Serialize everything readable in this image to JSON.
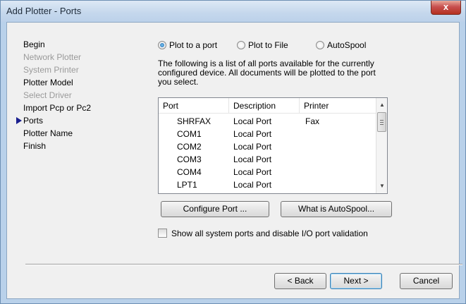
{
  "window": {
    "title": "Add Plotter - Ports",
    "close_label": "x"
  },
  "nav": {
    "items": [
      {
        "label": "Begin",
        "state": "normal"
      },
      {
        "label": "Network Plotter",
        "state": "disabled"
      },
      {
        "label": "System Printer",
        "state": "disabled"
      },
      {
        "label": "Plotter Model",
        "state": "normal"
      },
      {
        "label": "Select Driver",
        "state": "disabled"
      },
      {
        "label": "Import Pcp or Pc2",
        "state": "normal"
      },
      {
        "label": "Ports",
        "state": "current"
      },
      {
        "label": "Plotter Name",
        "state": "normal"
      },
      {
        "label": "Finish",
        "state": "normal"
      }
    ]
  },
  "radios": {
    "plot_to_port": {
      "label": "Plot to a port",
      "selected": true
    },
    "plot_to_file": {
      "label": "Plot to File",
      "selected": false
    },
    "autospool": {
      "label": "AutoSpool",
      "selected": false
    }
  },
  "description": "The following is a list of all ports available for the currently configured device. All documents will be plotted to the port you select.",
  "ports_table": {
    "columns": [
      "Port",
      "Description",
      "Printer"
    ],
    "rows": [
      [
        "SHRFAX",
        "Local Port",
        "Fax"
      ],
      [
        "COM1",
        "Local Port",
        ""
      ],
      [
        "COM2",
        "Local Port",
        ""
      ],
      [
        "COM3",
        "Local Port",
        ""
      ],
      [
        "COM4",
        "Local Port",
        ""
      ],
      [
        "LPT1",
        "Local Port",
        ""
      ]
    ]
  },
  "buttons": {
    "configure_port": "Configure Port ...",
    "what_is_autospool": "What is AutoSpool...",
    "back": "< Back",
    "next": "Next >",
    "cancel": "Cancel"
  },
  "show_all_ports": {
    "label": "Show all system ports and disable I/O port validation",
    "checked": false
  }
}
